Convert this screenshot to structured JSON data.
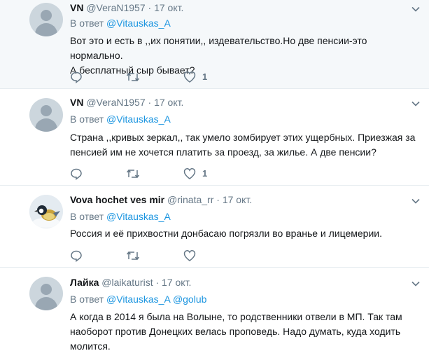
{
  "colors": {
    "accent": "#1b95e0",
    "muted": "#657786",
    "text": "#14171a",
    "highlight_bg": "#f5f8fa"
  },
  "tweets": [
    {
      "name": "VN",
      "handle": "@VeraN1957",
      "dot": "·",
      "date": "17 окт.",
      "reply_prefix": "В ответ",
      "mention1": "@Vitauskas_A",
      "mention2": "",
      "text_lines": [
        "Вот это и есть в ,,их понятии,, издевательство.Но две пенсии-это нормально.",
        "А бесплатный сыр бывает?"
      ],
      "likes": "1",
      "avatar_icon": "default-avatar-icon"
    },
    {
      "name": "VN",
      "handle": "@VeraN1957",
      "dot": "·",
      "date": "17 окт.",
      "reply_prefix": "В ответ",
      "mention1": "@Vitauskas_A",
      "mention2": "",
      "text_lines": [
        "Страна ,,кривых зеркал,, так умело зомбирует этих ущербных. Приезжая за",
        "пенсией им не хочется платить за проезд, за жилье. А две пенсии?"
      ],
      "likes": "1",
      "avatar_icon": "default-avatar-icon"
    },
    {
      "name": "Vova hochet ves mir",
      "handle": "@rinata_rr",
      "dot": "·",
      "date": "17 окт.",
      "reply_prefix": "В ответ",
      "mention1": "@Vitauskas_A",
      "mention2": "",
      "text_lines": [
        "Россия и её прихвостни донбасаю погрязли во вранье и лицемерии."
      ],
      "likes": "",
      "avatar_icon": "bird-avatar-icon"
    },
    {
      "name": "Лайка",
      "handle": "@laikaturist",
      "dot": "·",
      "date": "17 окт.",
      "reply_prefix": "В ответ",
      "mention1": "@Vitauskas_A",
      "mention2": "@golub",
      "text_lines": [
        "А когда в 2014 я была на Волыне, то родственники отвели в МП. Так там",
        "наоборот против Донецких велась проповедь. Надо думать, куда ходить",
        "молится."
      ],
      "likes": "",
      "avatar_icon": "default-avatar-icon"
    }
  ]
}
